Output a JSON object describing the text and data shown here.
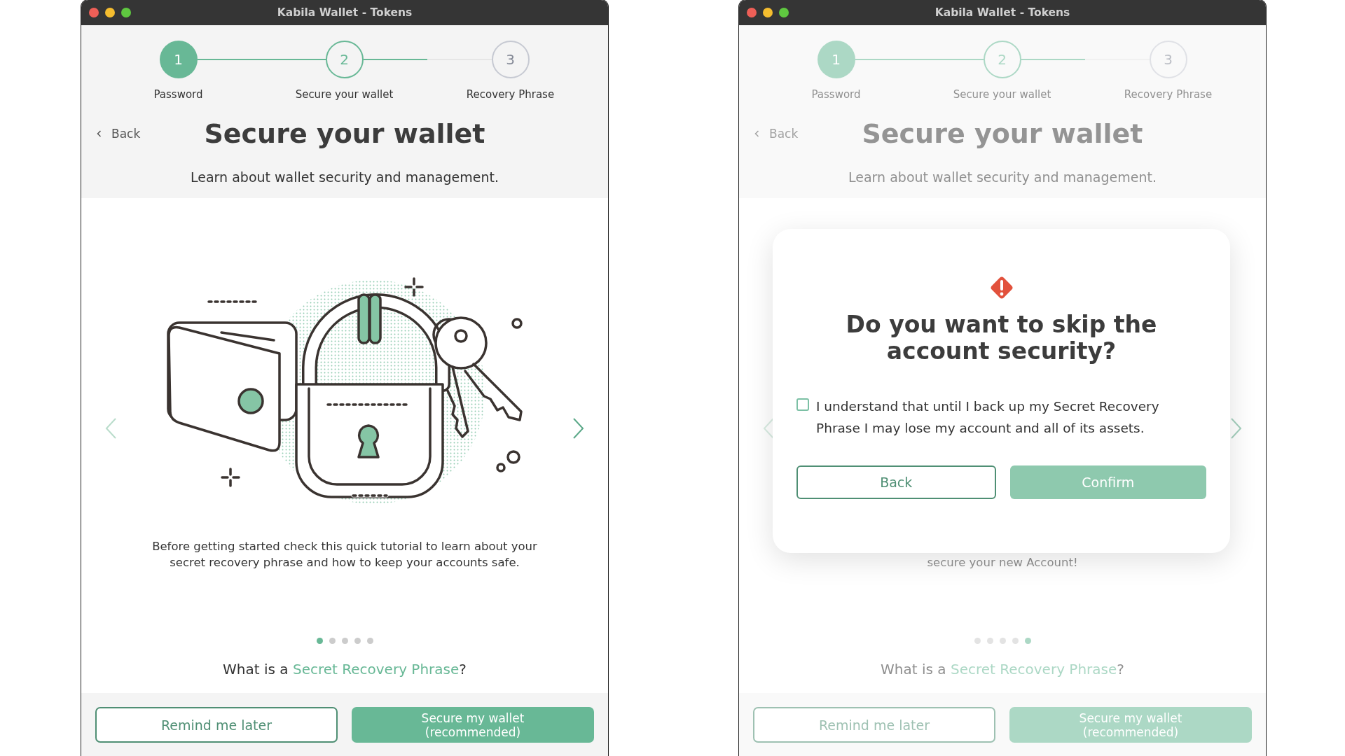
{
  "windows": [
    {
      "title": "Kabila Wallet - Tokens",
      "steps": [
        {
          "number": "1",
          "label": "Password",
          "completed": true,
          "selected": false
        },
        {
          "number": "2",
          "label": "Secure your wallet",
          "completed": false,
          "selected": true
        },
        {
          "number": "3",
          "label": "Recovery Phrase",
          "completed": false,
          "selected": false
        }
      ],
      "back": "Back",
      "heading": "Secure your wallet",
      "subtitle": "Learn about wallet security and management.",
      "slide": {
        "illustration": true,
        "caption": "Before getting started check this quick tutorial to learn about your secret recovery phrase and how to keep your accounts safe."
      },
      "slide_dots": [
        {
          "selected": true
        },
        {
          "selected": false
        },
        {
          "selected": false
        },
        {
          "selected": false
        },
        {
          "selected": false
        }
      ],
      "question": {
        "prefix": "What is a ",
        "link": "Secret Recovery Phrase",
        "suffix": "?"
      },
      "buttons": [
        {
          "label": "Remind me later",
          "kind": "outline"
        },
        {
          "label": "Secure my wallet (recommended)",
          "kind": "primary"
        }
      ]
    },
    {
      "title": "Kabila Wallet - Tokens",
      "dimmed": true,
      "steps": [
        {
          "number": "1",
          "label": "Password",
          "completed": true,
          "selected": false
        },
        {
          "number": "2",
          "label": "Secure your wallet",
          "completed": false,
          "selected": true
        },
        {
          "number": "3",
          "label": "Recovery Phrase",
          "completed": false,
          "selected": false
        }
      ],
      "back": "Back",
      "heading": "Secure your wallet",
      "subtitle": "Learn about wallet security and management.",
      "slide": {
        "caption": "secure your new Account!"
      },
      "slide_dots": [
        {
          "selected": false
        },
        {
          "selected": false
        },
        {
          "selected": false
        },
        {
          "selected": false
        },
        {
          "selected": true
        }
      ],
      "question": {
        "prefix": "What is a ",
        "link": "Secret Recovery Phrase",
        "suffix": "?"
      },
      "buttons": [
        {
          "label": "Remind me later",
          "kind": "outline"
        },
        {
          "label": "Secure my wallet (recommended)",
          "kind": "primary"
        }
      ],
      "dialog": {
        "heading": "Do you want to skip the account security?",
        "checkbox": {
          "label": "I understand that until I back up my Secret Recovery Phrase I may lose my account and all of its assets.",
          "checked": false
        },
        "buttons": [
          {
            "label": "Back",
            "kind": "outline",
            "disabled": false
          },
          {
            "label": "Confirm",
            "kind": "primary",
            "disabled": true
          }
        ]
      }
    }
  ]
}
